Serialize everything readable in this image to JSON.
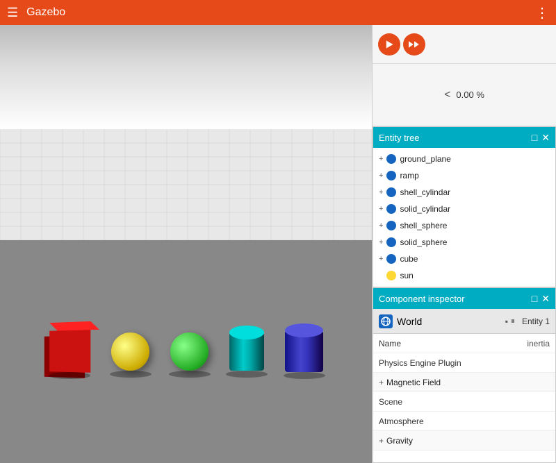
{
  "header": {
    "title": "Gazebo",
    "menu_label": "☰",
    "more_label": "⋮"
  },
  "toolbar": {
    "play_label": "▶",
    "fast_forward_label": "⏩"
  },
  "steps": {
    "chevron": "<",
    "percentage": "0.00 %"
  },
  "entity_tree": {
    "title": "Entity tree",
    "collapse_label": "□",
    "close_label": "✕",
    "items": [
      {
        "id": "ground_plane",
        "label": "ground_plane",
        "expandable": true,
        "type": "person"
      },
      {
        "id": "ramp",
        "label": "ramp",
        "expandable": true,
        "type": "person"
      },
      {
        "id": "shell_cylindar",
        "label": "shell_cylindar",
        "expandable": true,
        "type": "person"
      },
      {
        "id": "solid_cylindar",
        "label": "solid_cylindar",
        "expandable": true,
        "type": "person"
      },
      {
        "id": "shell_sphere",
        "label": "shell_sphere",
        "expandable": true,
        "type": "person"
      },
      {
        "id": "solid_sphere",
        "label": "solid_sphere",
        "expandable": true,
        "type": "person"
      },
      {
        "id": "cube",
        "label": "cube",
        "expandable": true,
        "type": "person"
      },
      {
        "id": "sun",
        "label": "sun",
        "expandable": false,
        "type": "sun"
      }
    ]
  },
  "component_inspector": {
    "title": "Component inspector",
    "collapse_label": "□",
    "close_label": "✕",
    "world": {
      "label": "World",
      "entity_label": "Entity 1",
      "pause_icon": "▪",
      "step_icon": "⏸"
    },
    "rows": [
      {
        "label": "Name",
        "value": "inertia",
        "type": "row"
      },
      {
        "label": "Physics Engine Plugin",
        "value": "",
        "type": "row"
      },
      {
        "label": "Magnetic Field",
        "value": "",
        "type": "section",
        "expandable": true
      },
      {
        "label": "Scene",
        "value": "",
        "type": "row"
      },
      {
        "label": "Atmosphere",
        "value": "",
        "type": "row"
      },
      {
        "label": "Gravity",
        "value": "",
        "type": "section",
        "expandable": true
      }
    ]
  },
  "objects": [
    {
      "id": "red-cube",
      "color": "#cc1111",
      "shape": "cube"
    },
    {
      "id": "yellow-sphere",
      "color": "#ddaa00",
      "shape": "sphere"
    },
    {
      "id": "green-sphere",
      "color": "#22aa22",
      "shape": "sphere"
    },
    {
      "id": "cyan-cylinder",
      "color": "#00aaaa",
      "shape": "cylinder"
    },
    {
      "id": "blue-cylinder",
      "color": "#2222aa",
      "shape": "cylinder"
    }
  ]
}
